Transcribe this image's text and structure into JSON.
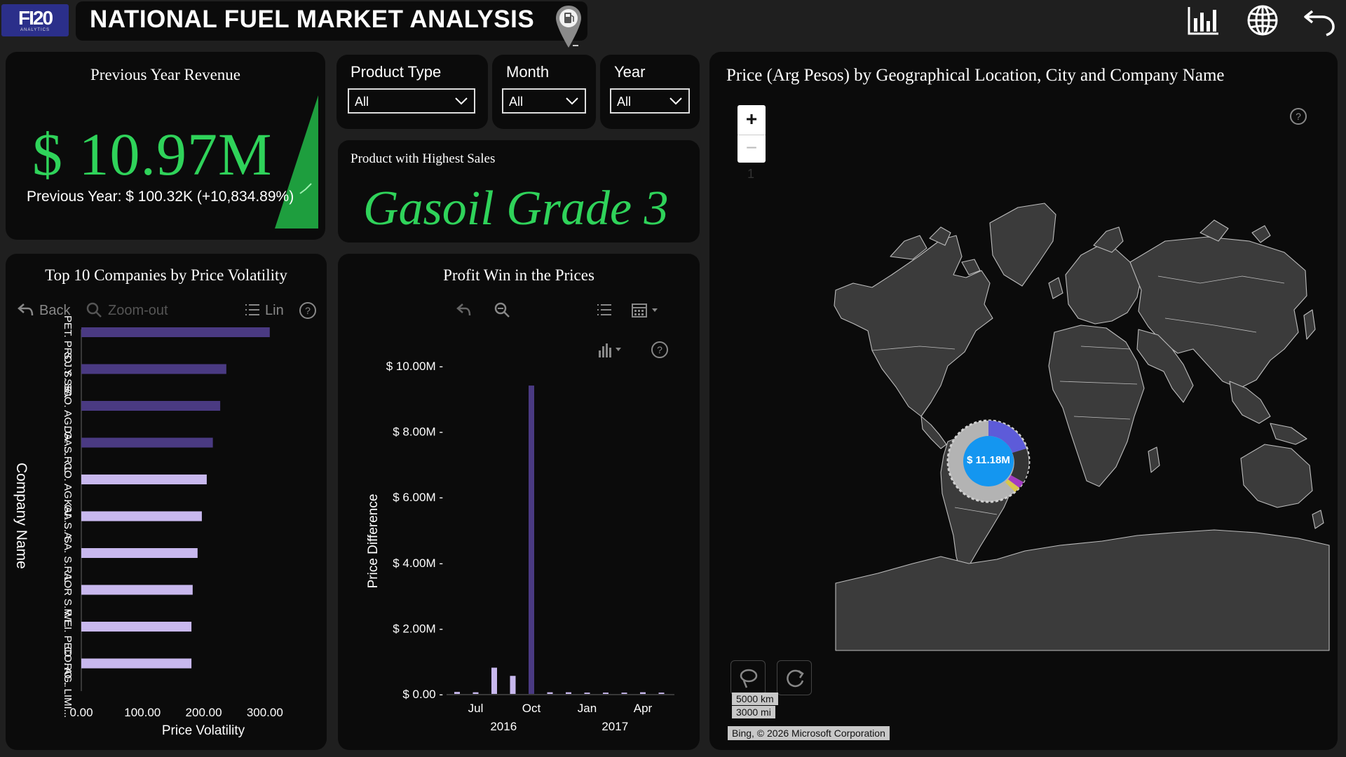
{
  "header": {
    "logo_text": "FI20",
    "logo_sub": "ANALYTICS",
    "title": "NATIONAL FUEL MARKET ANALYSIS",
    "icons": [
      "gas-pin-icon",
      "bar-chart-icon",
      "globe-icon",
      "undo-icon"
    ]
  },
  "revenue_card": {
    "title": "Previous Year Revenue",
    "value": "$ 10.97M",
    "subtitle": "Previous Year: $ 100.32K (+10,834.89%)"
  },
  "slicers": [
    {
      "label": "Product Type",
      "value": "All"
    },
    {
      "label": "Month",
      "value": "All"
    },
    {
      "label": "Year",
      "value": "All"
    }
  ],
  "product_card": {
    "label": "Product with Highest Sales",
    "value": "Gasoil Grade 3"
  },
  "volatility_chart": {
    "title": "Top 10 Companies by Price Volatility",
    "toolbar": {
      "back": "Back",
      "zoom_out": "Zoom-out",
      "lin": "Lin"
    },
    "chart_data": {
      "type": "bar",
      "orientation": "horizontal",
      "categories": [
        "PET. PRO. Y SE...",
        "S.J.S. SA",
        "CO. AG. GA...",
        "DA. S.R.L.",
        "CO. AG. GA...",
        "KAI. S.A.",
        "SA. S.R.L.",
        "AOR S.R.L.",
        "WEI. PED. RO...",
        "CO. AG. LIMI..."
      ],
      "values": [
        308,
        237,
        227,
        215,
        205,
        197,
        190,
        182,
        180,
        180
      ],
      "highlight_count": 4,
      "colors": {
        "dark": "#4a3a82",
        "light": "#c8b8ee"
      },
      "xlabel": "Price Volatility",
      "ylabel": "Company Name",
      "xticks": [
        "0.00",
        "100.00",
        "200.00",
        "300.00"
      ],
      "xlim": [
        0,
        330
      ]
    }
  },
  "profit_chart": {
    "title": "Profit Win in the Prices",
    "chart_data": {
      "type": "bar",
      "x": [
        "2016-06",
        "2016-07",
        "2016-08",
        "2016-09",
        "2016-10",
        "2016-11",
        "2016-12",
        "2017-01",
        "2017-02",
        "2017-03",
        "2017-04",
        "2017-05"
      ],
      "values": [
        0.06,
        0.05,
        0.8,
        0.55,
        9.4,
        0.05,
        0.05,
        0.04,
        0.04,
        0.04,
        0.05,
        0.04
      ],
      "highlight_index": 4,
      "colors": {
        "dark": "#4a3a82",
        "light": "#c8b8ee"
      },
      "ylabel": "Price Difference",
      "yticks": [
        "$ 0.00",
        "$ 2.00M",
        "$ 4.00M",
        "$ 6.00M",
        "$ 8.00M",
        "$ 10.00M"
      ],
      "ylim": [
        0,
        10
      ],
      "xticks": [
        "Jul",
        "Oct",
        "Jan",
        "Apr"
      ],
      "year_labels": [
        "2016",
        "2017"
      ]
    }
  },
  "map": {
    "title": "Price (Arg Pesos) by Geographical Location, City and Company Name",
    "bubble_value": "$ 11.18M",
    "zoom_level": "1",
    "scale": [
      "5000 km",
      "3000 mi"
    ],
    "attribution": "Bing, © 2026 Microsoft Corporation"
  }
}
